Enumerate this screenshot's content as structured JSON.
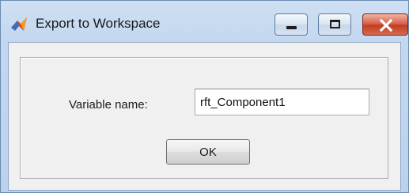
{
  "window": {
    "title": "Export to Workspace",
    "icon": "matlab-icon",
    "controls": {
      "minimize_icon": "minimize-icon",
      "maximize_icon": "maximize-icon",
      "close_icon": "close-icon"
    }
  },
  "form": {
    "variable_label": "Variable name:",
    "variable_value": "rft_Component1",
    "ok_label": "OK"
  },
  "colors": {
    "title_bar": "#c3d7ef",
    "close_button": "#c23d22",
    "dialog_background": "#f0f0f0"
  }
}
